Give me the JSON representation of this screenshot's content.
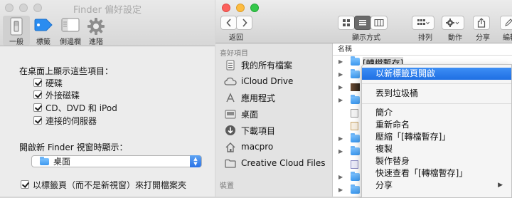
{
  "prefs_window": {
    "title": "Finder 偏好設定",
    "tabs": [
      {
        "label": "一般",
        "icon": "light-switch-icon",
        "active": true
      },
      {
        "label": "標籤",
        "icon": "tag-icon",
        "active": false
      },
      {
        "label": "側邊欄",
        "icon": "sidebar-icon",
        "active": false
      },
      {
        "label": "進階",
        "icon": "gear-icon",
        "active": false
      }
    ],
    "desktop_section_label": "在桌面上顯示這些項目：",
    "desktop_items": [
      {
        "label": "硬碟",
        "checked": true
      },
      {
        "label": "外接磁碟",
        "checked": true
      },
      {
        "label": "CD、DVD 和 iPod",
        "checked": true
      },
      {
        "label": "連接的伺服器",
        "checked": true
      }
    ],
    "new_window_label": "開啟新 Finder 視窗時顯示：",
    "new_window_selected": "桌面",
    "open_folders_in_tabs_label": "以標籤頁（而不是新視窗）來打開檔案夾",
    "open_folders_in_tabs_checked": true
  },
  "finder_window": {
    "toolbar": {
      "back_label": "返回",
      "view_label": "顯示方式",
      "arrange_label": "排列",
      "action_label": "動作",
      "share_label": "分享",
      "edit_label": "編輯"
    },
    "sidebar": {
      "favorites_heading": "喜好項目",
      "items": [
        {
          "label": "我的所有檔案",
          "icon": "all-files-icon"
        },
        {
          "label": "iCloud Drive",
          "icon": "cloud-icon"
        },
        {
          "label": "應用程式",
          "icon": "applications-icon"
        },
        {
          "label": "桌面",
          "icon": "desktop-icon"
        },
        {
          "label": "下載項目",
          "icon": "downloads-icon"
        },
        {
          "label": "macpro",
          "icon": "home-icon"
        },
        {
          "label": "Creative Cloud Files",
          "icon": "folder-icon"
        }
      ],
      "devices_heading": "裝置"
    },
    "column_header": "名稱",
    "selected_item_name": "[轉檔暫存]"
  },
  "context_menu": {
    "items": [
      {
        "label": "以新標籤頁開啟",
        "highlight": true
      },
      {
        "label": "丟到垃圾桶"
      },
      {
        "label": "簡介"
      },
      {
        "label": "重新命名"
      },
      {
        "label": "壓縮「[轉檔暫存]」"
      },
      {
        "label": "複製"
      },
      {
        "label": "製作替身"
      },
      {
        "label": "快速查看「[轉檔暫存]」"
      },
      {
        "label": "分享",
        "submenu": true
      }
    ]
  },
  "colors": {
    "selection_blue": "#2a74e6",
    "folder_blue": "#4aa3f2",
    "traffic_close": "#fc605c",
    "traffic_minimize": "#fdbc40",
    "traffic_zoom": "#34c84a"
  }
}
